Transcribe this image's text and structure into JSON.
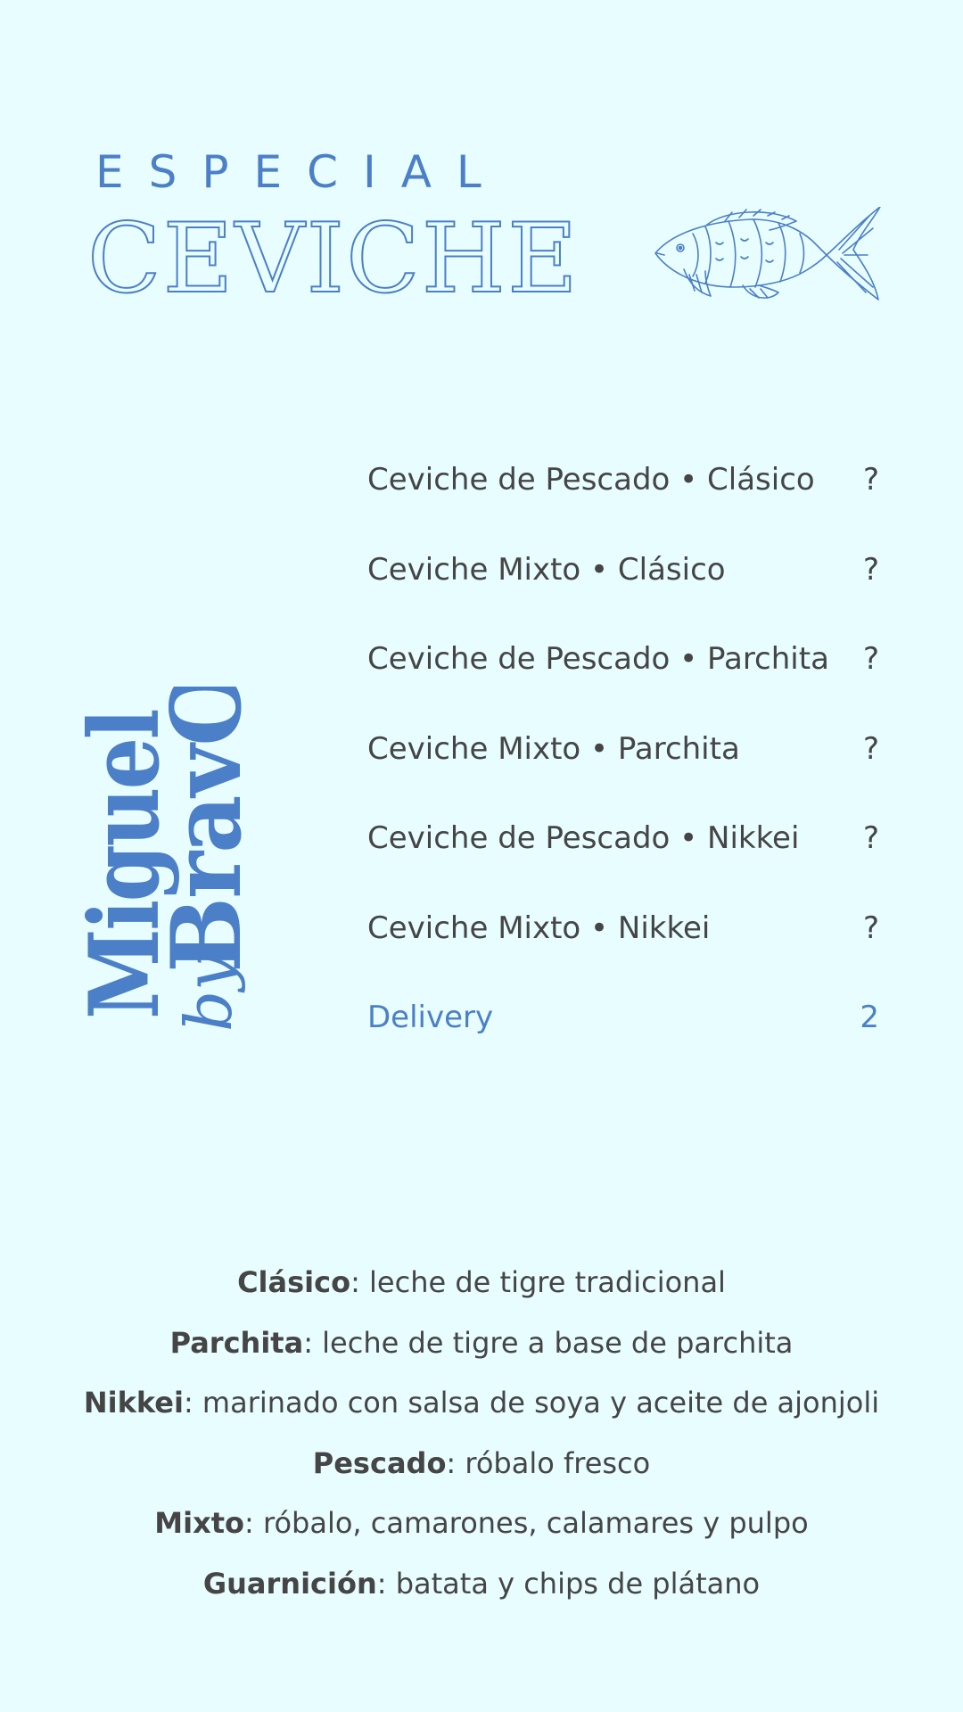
{
  "header": {
    "subtitle": "ESPECIAL",
    "title": "CEVICHE",
    "illustration_icon": "fish-icon"
  },
  "brand": {
    "logo_text": "Miguel by BravO",
    "color": "#4b7fc7"
  },
  "menu": {
    "items": [
      {
        "name": "Ceviche de Pescado • Clásico",
        "price": "?"
      },
      {
        "name": "Ceviche Mixto • Clásico",
        "price": "?"
      },
      {
        "name": "Ceviche de Pescado • Parchita",
        "price": "?"
      },
      {
        "name": "Ceviche Mixto • Parchita",
        "price": "?"
      },
      {
        "name": "Ceviche de Pescado • Nikkei",
        "price": "?"
      },
      {
        "name": "Ceviche Mixto • Nikkei",
        "price": "?"
      }
    ],
    "delivery": {
      "name": "Delivery",
      "price": "2"
    }
  },
  "notes": [
    {
      "term": "Clásico",
      "text": ": leche de tigre tradicional"
    },
    {
      "term": "Parchita",
      "text": ": leche de tigre a base de parchita"
    },
    {
      "term": "Nikkei",
      "text": ": marinado con salsa de soya y aceite de ajonjoli"
    },
    {
      "term": "Pescado",
      "text": ": róbalo fresco"
    },
    {
      "term": "Mixto",
      "text": ": róbalo, camarones, calamares y pulpo"
    },
    {
      "term": "Guarnición",
      "text": ": batata y chips de plátano"
    }
  ],
  "colors": {
    "background": "#e8fdff",
    "accent": "#4b7fc7",
    "text": "#454545"
  }
}
